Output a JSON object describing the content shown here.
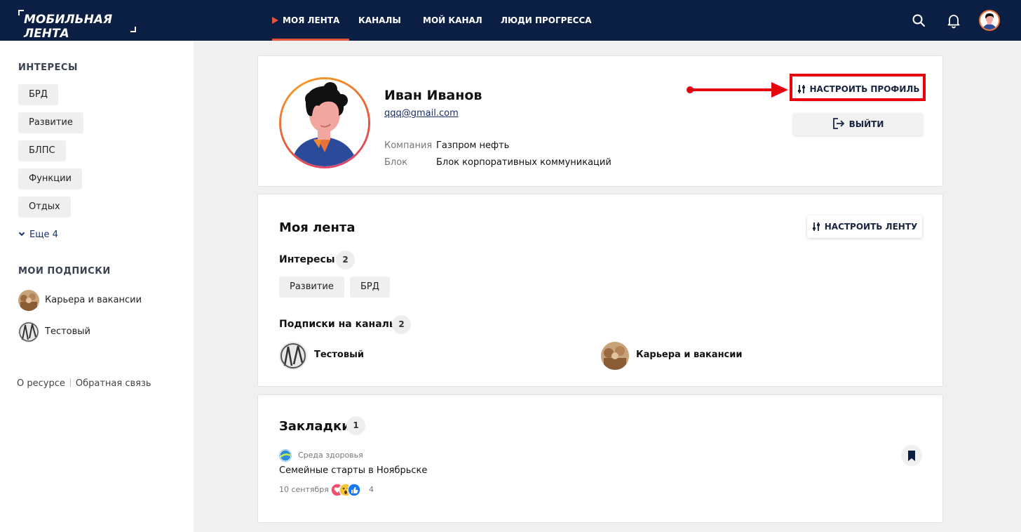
{
  "header": {
    "logo": "МОБИЛЬНАЯ ЛЕНТА",
    "nav": [
      {
        "label": "МОЯ ЛЕНТА",
        "active": true
      },
      {
        "label": "КАНАЛЫ",
        "active": false
      },
      {
        "label": "МОЙ КАНАЛ",
        "active": false
      },
      {
        "label": "ЛЮДИ ПРОГРЕССА",
        "active": false
      }
    ],
    "icons": [
      "search-icon",
      "bell-icon",
      "user-avatar"
    ]
  },
  "sidebar": {
    "interests_title": "ИНТЕРЕСЫ",
    "interests": [
      "БРД",
      "Развитие",
      "БЛПС",
      "Функции",
      "Отдых"
    ],
    "more_label": "Еще 4",
    "subs_title": "МОИ ПОДПИСКИ",
    "subscriptions": [
      "Карьера и вакансии",
      "Тестовый"
    ],
    "footer": {
      "about": "О ресурсе",
      "feedback": "Обратная связь"
    }
  },
  "profile": {
    "name": "Иван Иванов",
    "email": "qqq@gmail.com",
    "company_label": "Компания",
    "company_value": "Газпром нефть",
    "block_label": "Блок",
    "block_value": "Блок корпоративных коммуникаций",
    "setup_button": "НАСТРОИТЬ ПРОФИЛЬ",
    "logout_button": "ВЫЙТИ"
  },
  "feed": {
    "title": "Моя лента",
    "setup_button": "НАСТРОИТЬ ЛЕНТУ",
    "interests_label": "Интересы",
    "interests_count": "2",
    "interests": [
      "Развитие",
      "БРД"
    ],
    "channels_label": "Подписки на каналы",
    "channels_count": "2",
    "channels": [
      "Тестовый",
      "Карьера и вакансии"
    ]
  },
  "bookmarks": {
    "title": "Закладки",
    "count": "1",
    "item": {
      "source": "Среда здоровья",
      "title": "Семейные старты в Ноябрьске",
      "date": "10 сентября",
      "reactions_count": "4"
    }
  },
  "colors": {
    "header_bg": "#0b1e43",
    "accent": "#e8553e",
    "highlight_red": "#e8000f"
  }
}
